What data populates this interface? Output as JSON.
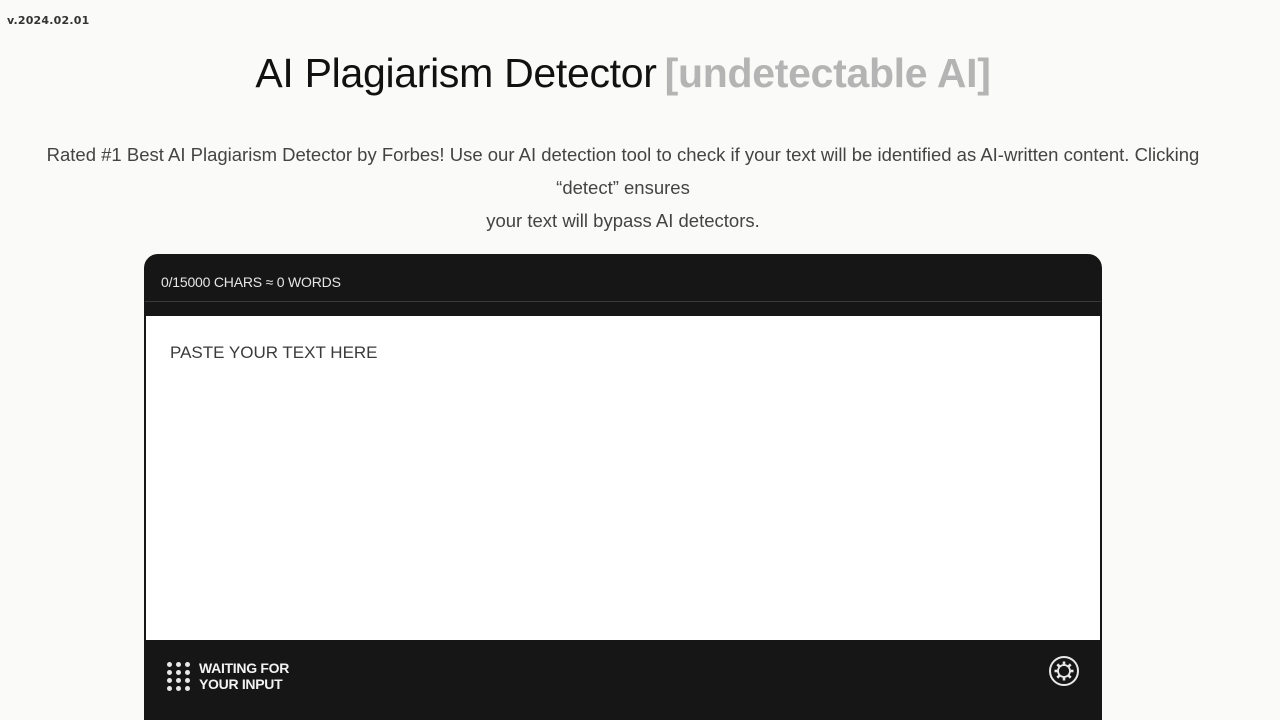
{
  "version": "v.2024.02.01",
  "header": {
    "title": "AI Plagiarism Detector",
    "title_accent": "[undetectable AI]",
    "subtitle_line1": "Rated #1 Best AI Plagiarism Detector by Forbes! Use our AI detection tool to check if your text will be identified as AI-written content. Clicking “detect” ensures",
    "subtitle_line2": "your text will bypass AI detectors."
  },
  "editor": {
    "char_count": "0/15000 CHARS ≈ 0 WORDS",
    "placeholder": "PASTE YOUR TEXT HERE",
    "value": ""
  },
  "footer": {
    "status_icon": "loading-dots-icon",
    "status_line1": "WAITING FOR",
    "status_line2": "YOUR INPUT",
    "settings_icon": "gear-icon"
  },
  "colors": {
    "background": "#fafaf8",
    "panel": "#161616",
    "accent_gray": "#b4b4b4"
  }
}
